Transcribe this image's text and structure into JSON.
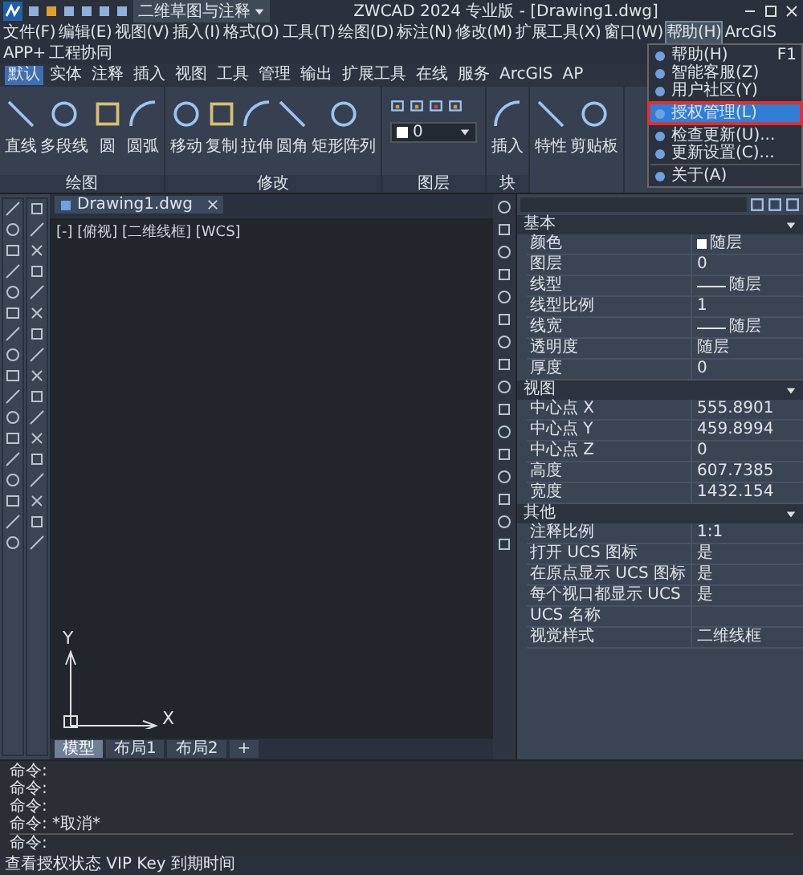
{
  "title_bar": {
    "workspace": "二维草图与注释",
    "title": "ZWCAD 2024 专业版 - [Drawing1.dwg]"
  },
  "menu_bar": [
    {
      "label": "文件(F)",
      "selected": false
    },
    {
      "label": "编辑(E)",
      "selected": false
    },
    {
      "label": "视图(V)",
      "selected": false
    },
    {
      "label": "插入(I)",
      "selected": false
    },
    {
      "label": "格式(O)",
      "selected": false
    },
    {
      "label": "工具(T)",
      "selected": false
    },
    {
      "label": "绘图(D)",
      "selected": false
    },
    {
      "label": "标注(N)",
      "selected": false
    },
    {
      "label": "修改(M)",
      "selected": false
    },
    {
      "label": "扩展工具(X)",
      "selected": false
    },
    {
      "label": "窗口(W)",
      "selected": false
    },
    {
      "label": "帮助(H)",
      "selected": true
    },
    {
      "label": "ArcGIS",
      "selected": false
    },
    {
      "label": "APP+",
      "selected": false
    },
    {
      "label": "工程协同",
      "selected": false
    }
  ],
  "ribbon_tabs": [
    {
      "label": "默认",
      "selected": true
    },
    {
      "label": "实体",
      "selected": false
    },
    {
      "label": "注释",
      "selected": false
    },
    {
      "label": "插入",
      "selected": false
    },
    {
      "label": "视图",
      "selected": false
    },
    {
      "label": "工具",
      "selected": false
    },
    {
      "label": "管理",
      "selected": false
    },
    {
      "label": "输出",
      "selected": false
    },
    {
      "label": "扩展工具",
      "selected": false
    },
    {
      "label": "在线",
      "selected": false
    },
    {
      "label": "服务",
      "selected": false
    },
    {
      "label": "ArcGIS",
      "selected": false
    },
    {
      "label": "AP",
      "selected": false
    }
  ],
  "ribbon_panels": [
    {
      "kind": "tools",
      "title": "绘图",
      "buttons": [
        "直线",
        "多段线",
        "圆",
        "圆弧"
      ]
    },
    {
      "kind": "tools",
      "title": "修改",
      "buttons": [
        "移动",
        "复制",
        "拉伸",
        "圆角",
        "矩形阵列"
      ]
    },
    {
      "kind": "layer",
      "title": "图层",
      "layer": "0"
    },
    {
      "kind": "tools",
      "title": "块",
      "buttons": [
        "插入"
      ]
    },
    {
      "kind": "tools",
      "buttons": [
        "特性",
        "剪贴板"
      ]
    }
  ],
  "help_menu": {
    "groups": [
      [
        {
          "label": "帮助(H)",
          "shortcut": "F1",
          "selected": false
        },
        {
          "label": "智能客服(Z)",
          "selected": false
        },
        {
          "label": "用户社区(Y)",
          "selected": false
        }
      ],
      [
        {
          "label": "授权管理(L)",
          "selected": true
        }
      ],
      [
        {
          "label": "检查更新(U)...",
          "selected": false
        },
        {
          "label": "更新设置(C)...",
          "selected": false
        }
      ],
      [
        {
          "label": "关于(A)",
          "selected": false
        }
      ]
    ]
  },
  "document_tab": "Drawing1.dwg",
  "viewport_label": "[-] [俯视] [二维线框] [WCS]",
  "axes": {
    "x": "X",
    "y": "Y"
  },
  "layout_tabs": [
    {
      "label": "模型",
      "selected": true
    },
    {
      "label": "布局1",
      "selected": false
    },
    {
      "label": "布局2",
      "selected": false
    },
    {
      "label": "+",
      "selected": false
    }
  ],
  "properties": {
    "groups": [
      {
        "title": "基本",
        "expanded": true,
        "rows": [
          {
            "kind": "color",
            "label": "颜色",
            "value": "随层"
          },
          {
            "kind": "text",
            "label": "图层",
            "value": "0"
          },
          {
            "kind": "linetype",
            "label": "线型",
            "value": "随层"
          },
          {
            "kind": "text",
            "label": "线型比例",
            "value": "1"
          },
          {
            "kind": "linetype",
            "label": "线宽",
            "value": "随层"
          },
          {
            "kind": "text",
            "label": "透明度",
            "value": "随层"
          },
          {
            "kind": "text",
            "label": "厚度",
            "value": "0"
          }
        ]
      },
      {
        "title": "视图",
        "expanded": true,
        "rows": [
          {
            "kind": "text",
            "label": "中心点 X",
            "value": "555.8901"
          },
          {
            "kind": "text",
            "label": "中心点 Y",
            "value": "459.8994"
          },
          {
            "kind": "text",
            "label": "中心点 Z",
            "value": "0"
          },
          {
            "kind": "text",
            "label": "高度",
            "value": "607.7385"
          },
          {
            "kind": "text",
            "label": "宽度",
            "value": "1432.154"
          }
        ]
      },
      {
        "title": "其他",
        "expanded": true,
        "rows": [
          {
            "kind": "text",
            "label": "注释比例",
            "value": "1:1"
          },
          {
            "kind": "text",
            "label": "打开 UCS 图标",
            "value": "是"
          },
          {
            "kind": "text",
            "label": "在原点显示 UCS 图标",
            "value": "是"
          },
          {
            "kind": "text",
            "label": "每个视口都显示 UCS",
            "value": "是"
          },
          {
            "kind": "text",
            "label": "UCS 名称"
          },
          {
            "kind": "text",
            "label": "视觉样式",
            "value": "二维线框"
          }
        ]
      }
    ]
  },
  "command_history": [
    "命令:",
    "命令:",
    "命令:",
    "命令: *取消*"
  ],
  "command_prompt": "命令:",
  "status_bar": "查看授权状态 VIP Key 到期时间"
}
